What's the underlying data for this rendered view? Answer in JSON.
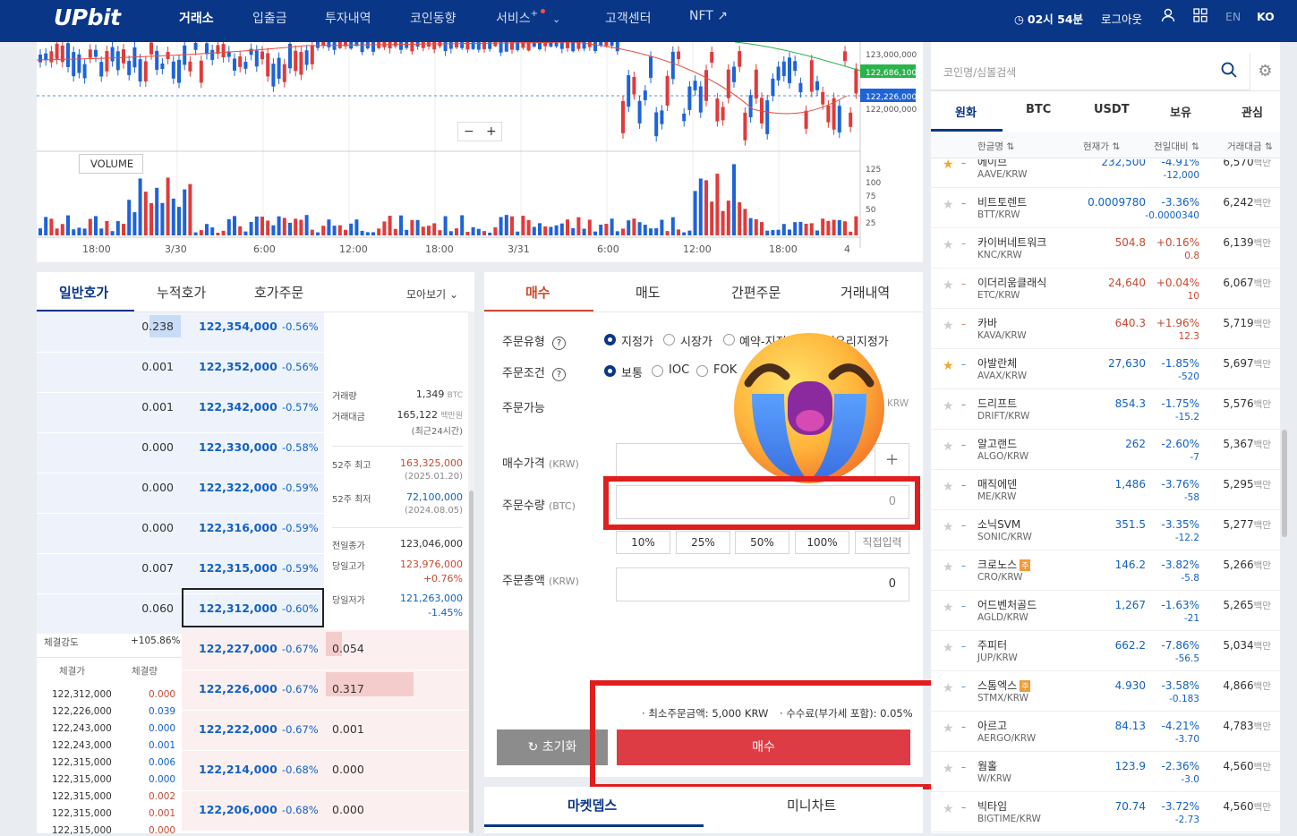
{
  "header": {
    "logo": "UPbit",
    "nav": [
      "거래소",
      "입출금",
      "투자내역",
      "코인동향",
      "서비스",
      "고객센터",
      "NFT ↗"
    ],
    "timer": "02시 54분",
    "logout": "로그아웃",
    "lang_en": "EN",
    "lang_ko": "KO"
  },
  "chart": {
    "price_labels": [
      "123,000,000",
      "122,686,100",
      "122,226,000",
      "122,000,000"
    ],
    "vol_label": "VOLUME",
    "vol_ticks": [
      "125",
      "100",
      "75",
      "50",
      "25"
    ],
    "x_ticks": [
      "18:00",
      "3/30",
      "6:00",
      "12:00",
      "18:00",
      "3/31",
      "6:00",
      "12:00",
      "18:00",
      "4"
    ],
    "zoom_minus": "−",
    "zoom_plus": "+",
    "colors": {
      "up": "#e13a3a",
      "down": "#1e63d8",
      "ma1": "#e84c3d",
      "ma2": "#2bb34b"
    }
  },
  "orderbook": {
    "tabs": [
      "일반호가",
      "누적호가",
      "호가주문"
    ],
    "view": "모아보기",
    "asks": [
      {
        "qty": "0.238",
        "price": "122,354,000",
        "pct": "-0.56%",
        "fill": 0.22
      },
      {
        "qty": "0.001",
        "price": "122,352,000",
        "pct": "-0.56%",
        "fill": 0
      },
      {
        "qty": "0.001",
        "price": "122,342,000",
        "pct": "-0.57%",
        "fill": 0
      },
      {
        "qty": "0.000",
        "price": "122,330,000",
        "pct": "-0.58%",
        "fill": 0
      },
      {
        "qty": "0.000",
        "price": "122,322,000",
        "pct": "-0.59%",
        "fill": 0
      },
      {
        "qty": "0.000",
        "price": "122,316,000",
        "pct": "-0.59%",
        "fill": 0
      },
      {
        "qty": "0.007",
        "price": "122,315,000",
        "pct": "-0.59%",
        "fill": 0
      },
      {
        "qty": "0.060",
        "price": "122,312,000",
        "pct": "-0.60%",
        "fill": 0
      }
    ],
    "bids": [
      {
        "qty": "0.054",
        "price": "122,227,000",
        "pct": "-0.67%",
        "fill": 0.15
      },
      {
        "qty": "0.317",
        "price": "122,226,000",
        "pct": "-0.67%",
        "fill": 0.82
      },
      {
        "qty": "0.001",
        "price": "122,222,000",
        "pct": "-0.67%",
        "fill": 0
      },
      {
        "qty": "0.000",
        "price": "122,214,000",
        "pct": "-0.68%",
        "fill": 0
      },
      {
        "qty": "0.000",
        "price": "122,206,000",
        "pct": "-0.68%",
        "fill": 0
      }
    ],
    "info": {
      "vol_l": "거래량",
      "vol": "1,349",
      "vol_u": "BTC",
      "amt_l": "거래대금",
      "amt": "165,122",
      "amt_u": "백만원",
      "amt_note": "(최근24시간)",
      "hi52_l": "52주 최고",
      "hi52": "163,325,000",
      "hi52_d": "(2025.01.20)",
      "lo52_l": "52주 최저",
      "lo52": "72,100,000",
      "lo52_d": "(2024.08.05)",
      "prev_l": "전일종가",
      "prev": "123,046,000",
      "dhi_l": "당일고가",
      "dhi": "123,976,000",
      "dhi_p": "+0.76%",
      "dlo_l": "당일저가",
      "dlo": "121,263,000",
      "dlo_p": "-1.45%"
    },
    "strength_l": "체결강도",
    "strength": "+105.86%",
    "trade_h1": "체결가",
    "trade_h2": "체결량",
    "trades": [
      {
        "p": "122,312,000",
        "q": "0.000",
        "c": "r"
      },
      {
        "p": "122,226,000",
        "q": "0.039",
        "c": "b"
      },
      {
        "p": "122,243,000",
        "q": "0.000",
        "c": "b"
      },
      {
        "p": "122,243,000",
        "q": "0.001",
        "c": "b"
      },
      {
        "p": "122,315,000",
        "q": "0.006",
        "c": "b"
      },
      {
        "p": "122,315,000",
        "q": "0.000",
        "c": "b"
      },
      {
        "p": "122,315,000",
        "q": "0.002",
        "c": "r"
      },
      {
        "p": "122,315,000",
        "q": "0.001",
        "c": "r"
      },
      {
        "p": "122,315,000",
        "q": "0.000",
        "c": "r"
      }
    ]
  },
  "order": {
    "tabs": [
      "매수",
      "매도",
      "간편주문",
      "거래내역"
    ],
    "type_l": "주문유형",
    "types": [
      "지정가",
      "시장가",
      "예약-지정가",
      "최유리지정가"
    ],
    "cond_l": "주문조건",
    "conds": [
      "보통",
      "IOC",
      "FOK"
    ],
    "avail_l": "주문가능",
    "avail_u": "KRW",
    "price_l": "매수가격",
    "price_u": "(KRW)",
    "qty_l": "주문수량",
    "qty_u": "(BTC)",
    "qty_val": "0",
    "pcts": [
      "10%",
      "25%",
      "50%",
      "100%",
      "직접입력"
    ],
    "total_l": "주문총액",
    "total_u": "(KRW)",
    "total_val": "0",
    "min": "최소주문금액: 5,000 KRW",
    "fee": "수수료(부가세 포함): 0.05%",
    "reset": "초기화",
    "buy": "매수"
  },
  "bottom_tabs": [
    "마켓뎁스",
    "미니차트"
  ],
  "market": {
    "search_ph": "코인명/심볼검색",
    "tabs": [
      "원화",
      "BTC",
      "USDT",
      "보유",
      "관심"
    ],
    "heads": [
      "한글명",
      "현재가",
      "전일대비",
      "거래대금"
    ],
    "unit": "백만",
    "rows": [
      {
        "n": "에이브",
        "s": "AAVE/KRW",
        "p": "232,500",
        "pct": "-4.91%",
        "chg": "-12,000",
        "v": "6,570",
        "c": "b",
        "star": true
      },
      {
        "n": "비트토렌트",
        "s": "BTT/KRW",
        "p": "0.0009780",
        "pct": "-3.36%",
        "chg": "-0.0000340",
        "v": "6,242",
        "c": "b",
        "star": false
      },
      {
        "n": "카이버네트워크",
        "s": "KNC/KRW",
        "p": "504.8",
        "pct": "+0.16%",
        "chg": "0.8",
        "v": "6,139",
        "c": "r",
        "star": false
      },
      {
        "n": "이더리움클래식",
        "s": "ETC/KRW",
        "p": "24,640",
        "pct": "+0.04%",
        "chg": "10",
        "v": "6,067",
        "c": "r",
        "star": false
      },
      {
        "n": "카바",
        "s": "KAVA/KRW",
        "p": "640.3",
        "pct": "+1.96%",
        "chg": "12.3",
        "v": "5,719",
        "c": "r",
        "star": false
      },
      {
        "n": "아발란체",
        "s": "AVAX/KRW",
        "p": "27,630",
        "pct": "-1.85%",
        "chg": "-520",
        "v": "5,697",
        "c": "b",
        "star": true
      },
      {
        "n": "드리프트",
        "s": "DRIFT/KRW",
        "p": "854.3",
        "pct": "-1.75%",
        "chg": "-15.2",
        "v": "5,576",
        "c": "b",
        "star": false
      },
      {
        "n": "알고랜드",
        "s": "ALGO/KRW",
        "p": "262",
        "pct": "-2.60%",
        "chg": "-7",
        "v": "5,367",
        "c": "b",
        "star": false
      },
      {
        "n": "매직에덴",
        "s": "ME/KRW",
        "p": "1,486",
        "pct": "-3.76%",
        "chg": "-58",
        "v": "5,295",
        "c": "b",
        "star": false
      },
      {
        "n": "소닉SVM",
        "s": "SONIC/KRW",
        "p": "351.5",
        "pct": "-3.35%",
        "chg": "-12.2",
        "v": "5,277",
        "c": "b",
        "star": false
      },
      {
        "n": "크로노스",
        "s": "CRO/KRW",
        "p": "146.2",
        "pct": "-3.82%",
        "chg": "-5.8",
        "v": "5,266",
        "c": "b",
        "star": false,
        "badge": "주"
      },
      {
        "n": "어드벤처골드",
        "s": "AGLD/KRW",
        "p": "1,267",
        "pct": "-1.63%",
        "chg": "-21",
        "v": "5,265",
        "c": "b",
        "star": false
      },
      {
        "n": "주피터",
        "s": "JUP/KRW",
        "p": "662.2",
        "pct": "-7.86%",
        "chg": "-56.5",
        "v": "5,034",
        "c": "b",
        "star": false
      },
      {
        "n": "스톰엑스",
        "s": "STMX/KRW",
        "p": "4.930",
        "pct": "-3.58%",
        "chg": "-0.183",
        "v": "4,866",
        "c": "b",
        "star": false,
        "badge": "주"
      },
      {
        "n": "아르고",
        "s": "AERGO/KRW",
        "p": "84.13",
        "pct": "-4.21%",
        "chg": "-3.70",
        "v": "4,783",
        "c": "b",
        "star": false
      },
      {
        "n": "웜홀",
        "s": "W/KRW",
        "p": "123.9",
        "pct": "-2.36%",
        "chg": "-3.0",
        "v": "4,560",
        "c": "b",
        "star": false
      },
      {
        "n": "빅타임",
        "s": "BIGTIME/KRW",
        "p": "70.74",
        "pct": "-3.72%",
        "chg": "-2.73",
        "v": "4,560",
        "c": "b",
        "star": false
      }
    ]
  }
}
